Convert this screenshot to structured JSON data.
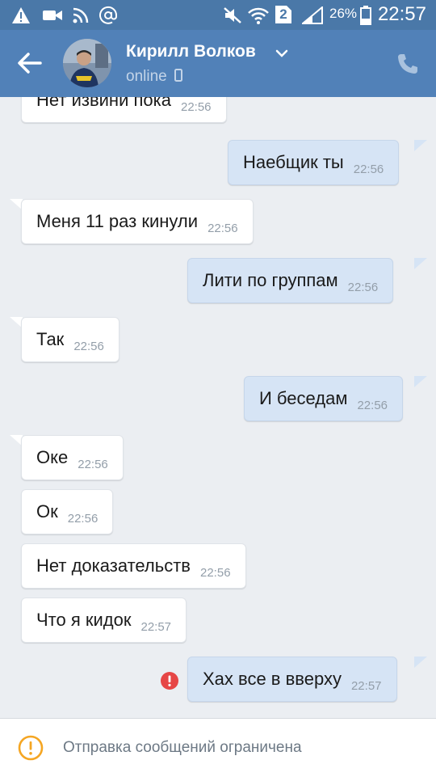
{
  "status_bar": {
    "battery": "26%",
    "sim_slot": "2",
    "time": "22:57"
  },
  "header": {
    "name": "Кирилл Волков",
    "status": "online"
  },
  "messages": [
    {
      "text": "Нет извини пока",
      "time": "22:56"
    },
    {
      "text": "Наебщик ты",
      "time": "22:56"
    },
    {
      "text": "Меня 11 раз кинули",
      "time": "22:56"
    },
    {
      "text": "Лити по группам",
      "time": "22:56"
    },
    {
      "text": "Так",
      "time": "22:56"
    },
    {
      "text": "И беседам",
      "time": "22:56"
    },
    {
      "text": "Оке",
      "time": "22:56"
    },
    {
      "text": "Ок",
      "time": "22:56"
    },
    {
      "text": "Нет доказательств",
      "time": "22:56"
    },
    {
      "text": "Что я кидок",
      "time": "22:57"
    },
    {
      "text": "Хах все в вверху",
      "time": "22:57"
    }
  ],
  "footer": {
    "notice": "Отправка сообщений ограничена"
  },
  "colors": {
    "header": "#5181b8",
    "status_bar": "#4a78a8",
    "incoming_bubble": "#ffffff",
    "outgoing_bubble": "#d6e4f5",
    "background": "#ebeef2",
    "error": "#e64646",
    "warning": "#f5a623"
  }
}
